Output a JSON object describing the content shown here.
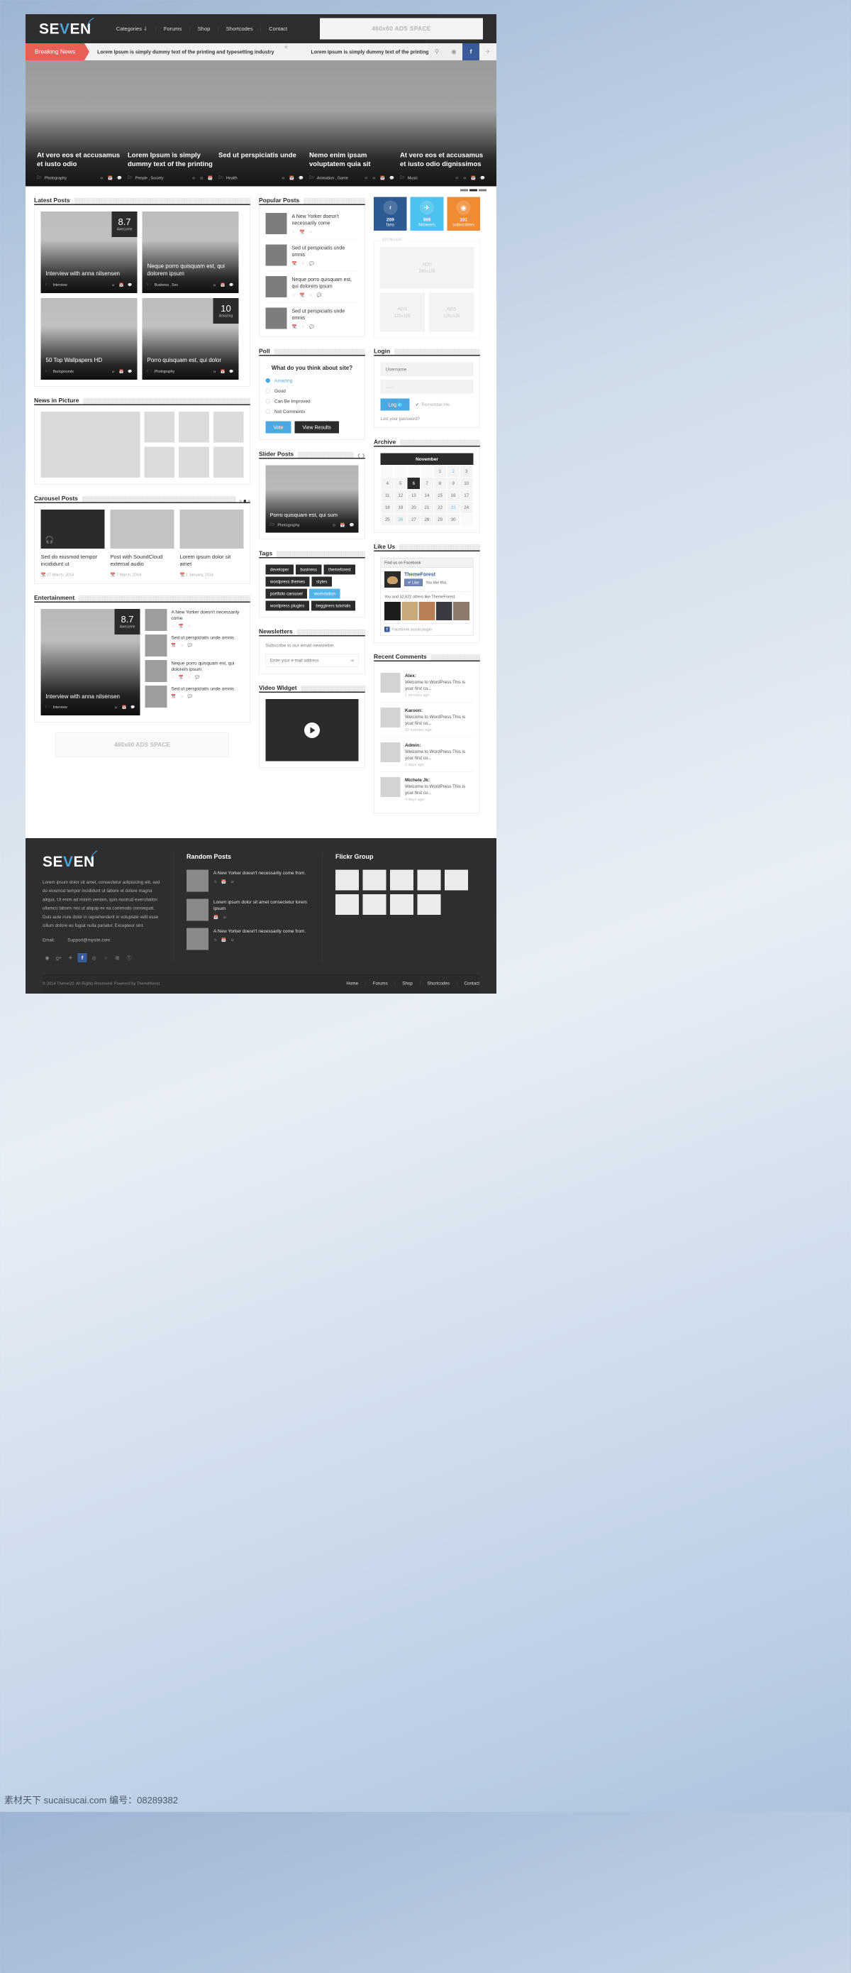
{
  "brand": {
    "name": "SEVEN",
    "accent": "#4aa3dd"
  },
  "header": {
    "nav": [
      {
        "label": "Categories ⇃"
      },
      {
        "label": "Forums"
      },
      {
        "label": "Shop"
      },
      {
        "label": "Shortcodes"
      },
      {
        "label": "Contact"
      }
    ],
    "ads_label": "460x60 ADS SPACE"
  },
  "breaking": {
    "label": "Breaking News",
    "item1": "Lorem Ipsum is simply dummy text of the printing and typesetting industry",
    "item2": "Lorem Ipsum is simply dummy text of the printing and typesetting ind",
    "icons": [
      "search-icon",
      "dribbble-icon",
      "facebook-icon",
      "twitter-icon"
    ]
  },
  "feature_slides": [
    {
      "title": "At vero eos et accusamus et iusto odio",
      "category": "Photography",
      "meta": "author date comments"
    },
    {
      "title": "Lorem Ipsum is simply dummy text of the printing",
      "category": "People , Society",
      "meta": "star author date"
    },
    {
      "title": "Sed ut perspiciatis unde",
      "category": "Health",
      "meta": "author date comments"
    },
    {
      "title": "Nemo enim ipsam voluptatem quia sit",
      "category": "Animation , Game",
      "meta": "star author date comments"
    },
    {
      "title": "At vero eos et accusamus et iusto odio dignissimos",
      "category": "Music",
      "meta": "star author date comments"
    }
  ],
  "latest_posts": {
    "title": "Latest Posts",
    "cards": [
      {
        "title": "Interview with anna nilsensen",
        "category": "Interview",
        "score": "8.7",
        "score_label": "Awesome",
        "has_badge": true
      },
      {
        "title": "Neque porro quisquam est, qui dolorem ipsum",
        "category": "Business , Seo",
        "score": "",
        "score_label": "",
        "has_badge": false
      },
      {
        "title": "50 Top Wallpapers HD",
        "category": "Backgrounds",
        "score": "",
        "score_label": "",
        "has_badge": false
      },
      {
        "title": "Porro quisquam est, qui dolor",
        "category": "Photography",
        "score": "10",
        "score_label": "Amazing",
        "has_badge": true
      }
    ]
  },
  "news_in_picture": {
    "title": "News in Picture"
  },
  "carousel_posts": {
    "title": "Carousel Posts",
    "items": [
      {
        "title": "Sed do eiusmod tempor incididunt ut",
        "date": "27 March, 2014",
        "dark": true
      },
      {
        "title": "Post with SoundCloud external audio",
        "date": "7 March, 2014",
        "dark": false
      },
      {
        "title": "Lorem ipsum dolor sit amet",
        "date": "1 January, 2014",
        "dark": false
      }
    ]
  },
  "entertainment": {
    "title": "Entertainment",
    "feature": {
      "title": "Interview with anna nilsensen",
      "category": "Interview",
      "score": "8.7",
      "score_label": "Awesome"
    },
    "items": [
      {
        "title": "A New Yorker doesn't necessarily come"
      },
      {
        "title": "Sed ut perspiciatis unde omnis"
      },
      {
        "title": "Neque porro quisquam est, qui dolorem ipsum"
      },
      {
        "title": "Sed ut perspiciatis unde omnis"
      }
    ]
  },
  "bottom_ads": "460x60 ADS SPACE",
  "popular_posts": {
    "title": "Popular Posts",
    "items": [
      {
        "title": "A New Yorker doesn't necessarily come"
      },
      {
        "title": "Sed ut perspiciatis unde omnis"
      },
      {
        "title": "Neque porro quisquam est, qui dolorem ipsum"
      },
      {
        "title": "Sed ut perspiciatis unde omnis"
      }
    ]
  },
  "poll": {
    "title": "Poll",
    "question": "What do you think about site?",
    "options": [
      {
        "label": "Amazing",
        "selected": true
      },
      {
        "label": "Good",
        "selected": false
      },
      {
        "label": "Can Be Improved",
        "selected": false
      },
      {
        "label": "Not Comments",
        "selected": false
      }
    ],
    "vote_label": "Vote",
    "results_label": "View Results"
  },
  "slider_posts": {
    "title": "Slider Posts",
    "slide_title": "Porro quisquam est, qui sum",
    "category": "Photography"
  },
  "tags": {
    "title": "Tags",
    "items": [
      {
        "label": "developer",
        "active": false
      },
      {
        "label": "business",
        "active": false
      },
      {
        "label": "themeforest",
        "active": false
      },
      {
        "label": "wordpress themes",
        "active": false
      },
      {
        "label": "styles",
        "active": false
      },
      {
        "label": "portfolio carousel",
        "active": false
      },
      {
        "label": "workstation",
        "active": true
      },
      {
        "label": "wordpress plugins",
        "active": false
      },
      {
        "label": "begginers tutorials",
        "active": false
      }
    ]
  },
  "newsletters": {
    "title": "Newsletters",
    "text": "Subscribe to our email newsletter.",
    "placeholder": "Enter your e-mail address"
  },
  "video_widget": {
    "title": "Video Widget"
  },
  "counters": [
    {
      "icon": "facebook-icon",
      "glyph": "f",
      "count": "259",
      "label": "fans",
      "color": "#2d5a92"
    },
    {
      "icon": "twitter-icon",
      "glyph": "✉",
      "count": "568",
      "label": "followers",
      "color": "#4cc2ee"
    },
    {
      "icon": "rss-icon",
      "glyph": "⦸",
      "count": "101",
      "label": "subscribers",
      "color": "#ef8b33"
    }
  ],
  "sponsor": {
    "label": "SPONSOR",
    "big": {
      "name": "ADS",
      "size": "260x125"
    },
    "small": [
      {
        "name": "ADS",
        "size": "125x125"
      },
      {
        "name": "ADS",
        "size": "125x125"
      }
    ]
  },
  "login": {
    "title": "Login",
    "username_placeholder": "Username",
    "password_value": "......",
    "button": "Log in",
    "remember": "Remember Me",
    "lost": "Lost your password?"
  },
  "archive": {
    "title": "Archive",
    "month": "November",
    "weeks": [
      [
        "",
        "",
        "",
        "",
        "1",
        "2",
        "3"
      ],
      [
        "4",
        "5",
        "6",
        "7",
        "8",
        "9",
        "10"
      ],
      [
        "11",
        "12",
        "13",
        "14",
        "15",
        "16",
        "17"
      ],
      [
        "18",
        "19",
        "20",
        "21",
        "22",
        "23",
        "24"
      ],
      [
        "25",
        "26",
        "27",
        "28",
        "29",
        "30",
        ""
      ]
    ],
    "today": "6",
    "links": [
      "2",
      "23",
      "26"
    ]
  },
  "like_us": {
    "title": "Like Us",
    "header": "Find us on Facebook",
    "page_name": "ThemeForest",
    "like_label": "✔ Like",
    "you_like": "You like this.",
    "others": "You and 32,622 others like ThemeForest.",
    "footer": "Facebook social plugin"
  },
  "recent_comments": {
    "title": "Recent Comments",
    "items": [
      {
        "author": "Alex:",
        "text": "Welcome to WordPress This is your first co...",
        "ago": "1 minutes ago"
      },
      {
        "author": "Karoon:",
        "text": "Welcome to WordPress This is your first co...",
        "ago": "50 minutes ago"
      },
      {
        "author": "Admin:",
        "text": "Welcome to WordPress This is your first co...",
        "ago": "3 days ago"
      },
      {
        "author": "Michele Jk:",
        "text": "Welcome to WordPress This is your first co...",
        "ago": "4 days ago"
      }
    ]
  },
  "footer": {
    "about": "Lorem ipsum dolor sit amet, consectetur adipisicing elit, sed do eiusmod tempor incididunt ut labore et dolore magna aliqua. Ut enim ad minim veniam, quis nostrud exercitation ullamco laboris nisi ut aliquip ex ea commodo consequat. Duis aute irure dolor in reprehenderit in voluptate velit esse cillum dolore eu fugiat nulla pariatur. Excepteur sint.",
    "email_label": "Email:",
    "email": "Support@mysite.com",
    "social": [
      "dribbble-icon",
      "google-plus-icon",
      "twitter-icon",
      "facebook-icon",
      "rss-icon",
      "github-icon",
      "linkedin-icon",
      "pinterest-icon"
    ],
    "random_posts": {
      "title": "Random Posts",
      "items": [
        {
          "title": "A New Yorker doesn't necessarily come from."
        },
        {
          "title": "Lorem ipsum dolor sit amet consectetur lorem ipsum"
        },
        {
          "title": "A New Yorker doesn't necessarily come from."
        }
      ]
    },
    "flickr": {
      "title": "Flickr Group"
    },
    "copyright": "© 2014 Theme20. All Rights Reserved. Powered by Themeforest.",
    "nav": [
      {
        "label": "Home"
      },
      {
        "label": "Forums"
      },
      {
        "label": "Shop"
      },
      {
        "label": "Shortcodes"
      },
      {
        "label": "Contact"
      }
    ]
  },
  "watermark": {
    "text": "素材天下 sucaisucai.com 编号：08289382"
  }
}
